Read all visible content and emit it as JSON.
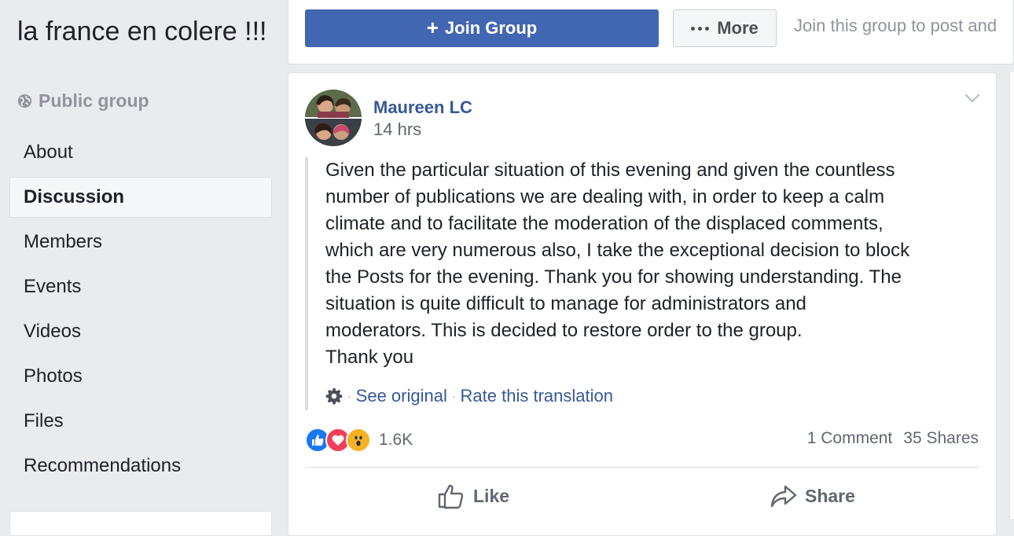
{
  "sidebar": {
    "group_name": "la france en colere !!!",
    "privacy": "Public group",
    "nav": [
      {
        "label": "About"
      },
      {
        "label": "Discussion",
        "active": true
      },
      {
        "label": "Members"
      },
      {
        "label": "Events"
      },
      {
        "label": "Videos"
      },
      {
        "label": "Photos"
      },
      {
        "label": "Files"
      },
      {
        "label": "Recommendations"
      }
    ]
  },
  "topbar": {
    "join_label": "Join Group",
    "more_label": "More",
    "join_hint": "Join this group to post and"
  },
  "post": {
    "author": "Maureen LC",
    "time": "14 hrs",
    "text": "Given the particular situation of this evening and given the countless\nnumber of publications we are dealing with, in order to keep a calm\nclimate and to facilitate the moderation of the displaced comments,\nwhich are very numerous also, I take the exceptional decision to block\nthe Posts for the evening. Thank you for showing understanding. The\nsituation is quite difficult to manage for administrators and\nmoderators. This is decided to restore order to the group.\nThank you",
    "see_original": "See original",
    "rate_translation": "Rate this translation",
    "reactions": [
      "like",
      "love",
      "wow"
    ],
    "reaction_count": "1.6K",
    "comments": "1 Comment",
    "shares": "35 Shares",
    "like_label": "Like",
    "share_label": "Share"
  },
  "colors": {
    "brand_blue": "#4267b2",
    "link_blue": "#365899",
    "background": "#e9ebee"
  }
}
